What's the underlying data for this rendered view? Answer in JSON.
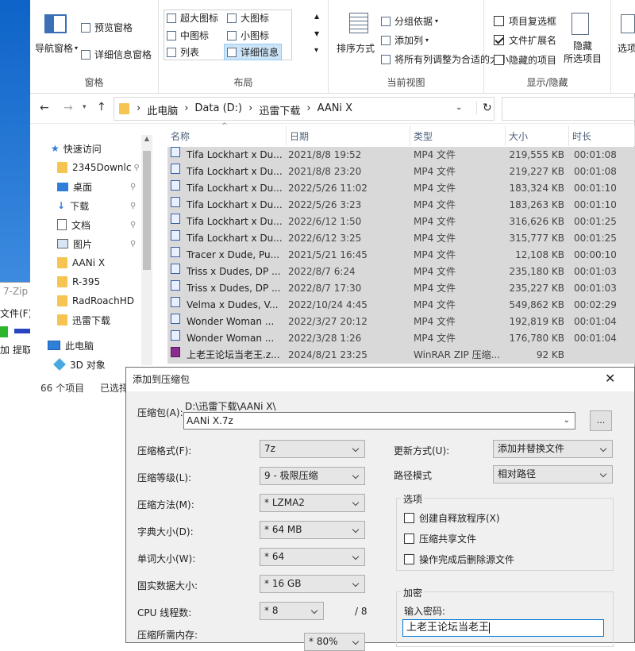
{
  "ribbon": {
    "pane": {
      "nav": "导航窗格",
      "preview": "预览窗格",
      "details": "详细信息窗格",
      "group": "窗格"
    },
    "layout": {
      "xl": "超大图标",
      "large": "大图标",
      "medium": "中图标",
      "small": "小图标",
      "list": "列表",
      "details": "详细信息",
      "group": "布局"
    },
    "view": {
      "sort": "排序方式",
      "groupby": "分组依据",
      "addcol": "添加列",
      "fit": "将所有列调整为合适的大小",
      "group": "当前视图"
    },
    "showhide": {
      "checkboxes": "项目复选框",
      "ext": "文件扩展名",
      "hidden": "隐藏的项目",
      "hide_sel_1": "隐藏",
      "hide_sel_2": "所选项目",
      "group": "显示/隐藏"
    },
    "options": "选项"
  },
  "address": {
    "crumbs": [
      "此电脑",
      "Data (D:)",
      "迅雷下载",
      "AANi X"
    ]
  },
  "nav": [
    {
      "label": "快速访问",
      "icon": "star-icon"
    },
    {
      "label": "2345Downlc",
      "icon": "folder-icon",
      "pin": true
    },
    {
      "label": "桌面",
      "icon": "desktop-icon",
      "pin": true
    },
    {
      "label": "下载",
      "icon": "download-icon",
      "pin": true
    },
    {
      "label": "文档",
      "icon": "document-icon",
      "pin": true
    },
    {
      "label": "图片",
      "icon": "picture-icon",
      "pin": true
    },
    {
      "label": "AANi X",
      "icon": "folder-icon"
    },
    {
      "label": "R-395",
      "icon": "folder-icon"
    },
    {
      "label": "RadRoachHD",
      "icon": "folder-icon"
    },
    {
      "label": "迅雷下载",
      "icon": "folder-icon"
    },
    {
      "label": "此电脑",
      "icon": "computer-icon"
    },
    {
      "label": "3D 对象",
      "icon": "cube-icon"
    }
  ],
  "columns": [
    "名称",
    "日期",
    "类型",
    "大小",
    "时长"
  ],
  "files": [
    {
      "name": "Tifa Lockhart x Du...",
      "date": "2021/8/8 19:52",
      "type": "MP4 文件",
      "size": "219,555 KB",
      "dur": "00:01:08"
    },
    {
      "name": "Tifa Lockhart x Du...",
      "date": "2021/8/8 23:20",
      "type": "MP4 文件",
      "size": "219,227 KB",
      "dur": "00:01:08"
    },
    {
      "name": "Tifa Lockhart x Du...",
      "date": "2022/5/26 11:02",
      "type": "MP4 文件",
      "size": "183,324 KB",
      "dur": "00:01:10"
    },
    {
      "name": "Tifa Lockhart x Du...",
      "date": "2022/5/26 3:23",
      "type": "MP4 文件",
      "size": "183,263 KB",
      "dur": "00:01:10"
    },
    {
      "name": "Tifa Lockhart x Du...",
      "date": "2022/6/12 1:50",
      "type": "MP4 文件",
      "size": "316,626 KB",
      "dur": "00:01:25"
    },
    {
      "name": "Tifa Lockhart x Du...",
      "date": "2022/6/12 3:25",
      "type": "MP4 文件",
      "size": "315,777 KB",
      "dur": "00:01:25"
    },
    {
      "name": "Tracer x Dude, Pu...",
      "date": "2021/5/21 16:45",
      "type": "MP4 文件",
      "size": "12,108 KB",
      "dur": "00:00:10"
    },
    {
      "name": "Triss x Dudes, DP ...",
      "date": "2022/8/7 6:24",
      "type": "MP4 文件",
      "size": "235,180 KB",
      "dur": "00:01:03"
    },
    {
      "name": "Triss x Dudes, DP ...",
      "date": "2022/8/7 17:30",
      "type": "MP4 文件",
      "size": "235,227 KB",
      "dur": "00:01:03"
    },
    {
      "name": "Velma x Dudes, V...",
      "date": "2022/10/24 4:45",
      "type": "MP4 文件",
      "size": "549,862 KB",
      "dur": "00:02:29"
    },
    {
      "name": "Wonder Woman ...",
      "date": "2022/3/27 20:12",
      "type": "MP4 文件",
      "size": "192,819 KB",
      "dur": "00:01:04"
    },
    {
      "name": "Wonder Woman ...",
      "date": "2022/3/28 1:26",
      "type": "MP4 文件",
      "size": "176,780 KB",
      "dur": "00:01:04"
    },
    {
      "name": "上老王论坛当老王.z...",
      "date": "2024/8/21 23:25",
      "type": "WinRAR ZIP 压缩...",
      "size": "92 KB",
      "dur": ""
    }
  ],
  "status": {
    "count": "66 个项目",
    "selected": "已选择"
  },
  "bg_window": {
    "title": "7-Zip",
    "menu": "文件(F)",
    "btn1": "加",
    "btn2": "提取"
  },
  "dialog": {
    "title": "添加到压缩包",
    "archive_label": "压缩包(A):",
    "archive_path": "D:\\迅雷下载\\AANi X\\",
    "archive_name": "AANi X.7z",
    "browse": "...",
    "format_label": "压缩格式(F):",
    "format": "7z",
    "level_label": "压缩等级(L):",
    "level": "9 - 极限压缩",
    "method_label": "压缩方法(M):",
    "method": "* LZMA2",
    "dict_label": "字典大小(D):",
    "dict": "* 64 MB",
    "word_label": "单词大小(W):",
    "word": "* 64",
    "solid_label": "固实数据大小:",
    "solid": "* 16 GB",
    "threads_label": "CPU 线程数:",
    "threads": "* 8",
    "threads_total": "/ 8",
    "mem_label": "压缩所需内存:",
    "mem_value": "* 80%",
    "update_label": "更新方式(U):",
    "update": "添加并替换文件",
    "path_label": "路径模式",
    "path": "相对路径",
    "options_title": "选项",
    "opt_sfx": "创建自释放程序(X)",
    "opt_shared": "压缩共享文件",
    "opt_delete": "操作完成后删除源文件",
    "enc_title": "加密",
    "pwd_label": "输入密码:",
    "pwd_value": "上老王论坛当老王"
  }
}
